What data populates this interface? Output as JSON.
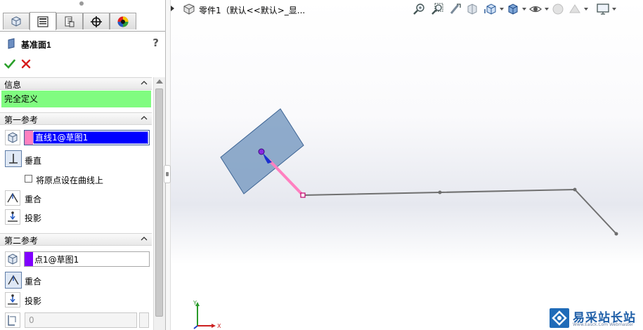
{
  "property_manager": {
    "title": "基准面1",
    "help": "?",
    "tabs": [
      {
        "name": "feature-manager",
        "icon": "feature-tree-icon"
      },
      {
        "name": "property-manager",
        "icon": "property-manager-icon",
        "active": true
      },
      {
        "name": "configuration-manager",
        "icon": "configuration-icon"
      },
      {
        "name": "dimxpert-manager",
        "icon": "crosshair-icon"
      },
      {
        "name": "display-manager",
        "icon": "appearance-sphere-icon"
      }
    ],
    "info": {
      "header": "信息",
      "state": "完全定义",
      "state_color": "#80FC80"
    },
    "first_ref": {
      "header": "第一参考",
      "selection": "直线1@草图1",
      "selection_color": "#FF80C0",
      "option_perpendicular": "垂直",
      "checkbox_label": "将原点设在曲线上",
      "option_coincident": "重合",
      "option_project": "投影"
    },
    "second_ref": {
      "header": "第二参考",
      "selection": "点1@草图1",
      "selection_color": "#8000FF",
      "option_coincident": "重合",
      "option_project": "投影",
      "angle_value": "0"
    }
  },
  "graphics": {
    "document_title": "零件1（默认<<默认>_显...",
    "hud_icons": [
      "zoom-to-fit-icon",
      "zoom-to-area-icon",
      "previous-view-icon",
      "section-view-icon",
      "view-orientation-icon",
      "display-style-icon",
      "hide-show-items-icon",
      "edit-appearance-icon",
      "apply-scene-icon",
      "view-settings-icon"
    ],
    "triad": {
      "x_label": "X",
      "y_label": "Y"
    },
    "plane_color": "#7f9fc4",
    "sketch_line_color": "#707070",
    "selected_line_color": "#ff80c0"
  },
  "watermark": {
    "text": "易采站长站",
    "subtext": "Www.Easck.Com Webmaster"
  }
}
